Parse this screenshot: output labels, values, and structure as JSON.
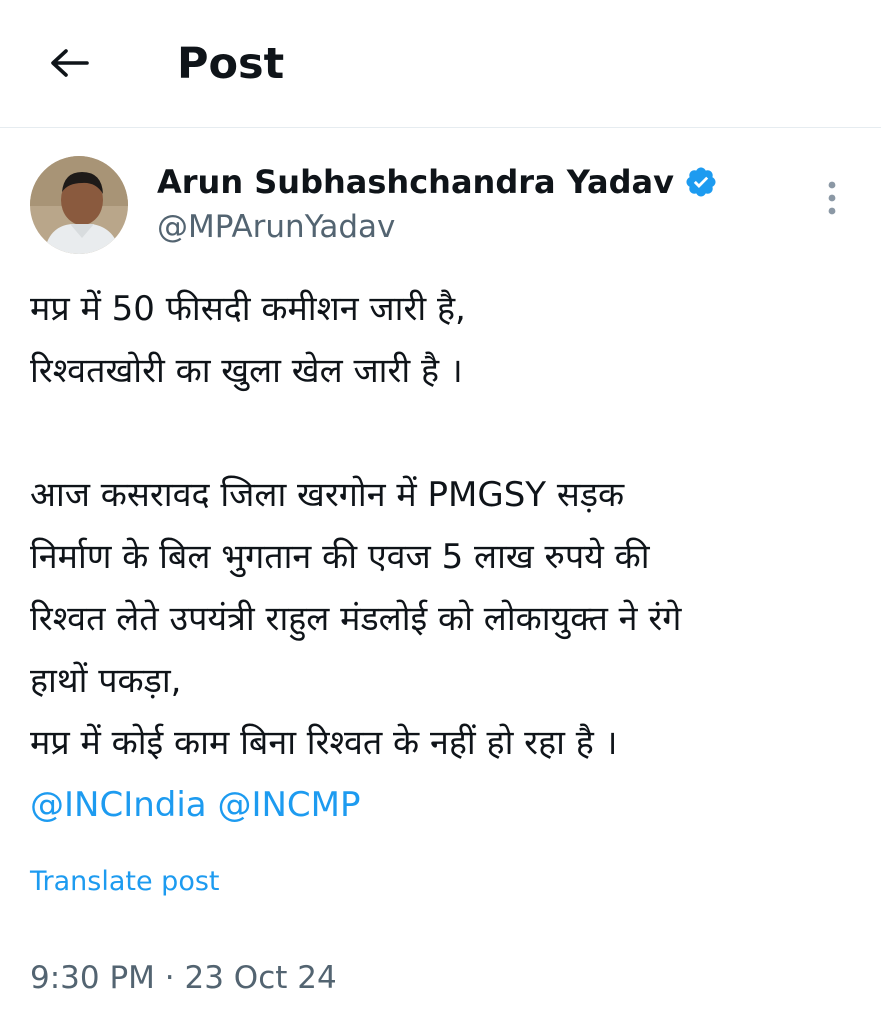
{
  "header": {
    "title": "Post",
    "back_icon": "arrow-left-icon"
  },
  "author": {
    "name": "Arun Subhashchandra Yadav",
    "handle": "@MPArunYadav",
    "verified": true,
    "verified_color": "#1d9bf0"
  },
  "post": {
    "lines": [
      "मप्र में 50 फीसदी कमीशन जारी है,",
      "रिश्वतखोरी का खुला खेल जारी है ।",
      "",
      "आज कसरावद जिला खरगोन में PMGSY सड़क",
      "निर्माण के बिल भुगतान की एवज 5 लाख रुपये की",
      "रिश्वत लेते उपयंत्री राहुल मंडलोई को लोकायुक्त ने रंगे",
      "हाथों पकड़ा,",
      "मप्र में कोई काम बिना रिश्वत के नहीं हो रहा है ।"
    ],
    "mentions": [
      "@INCIndia",
      "@INCMP"
    ],
    "translate_label": "Translate post",
    "time": "9:30 PM",
    "separator": "·",
    "date": "23 Oct 24"
  },
  "colors": {
    "link": "#1d9bf0",
    "secondary_text": "#536471",
    "primary_text": "#0f1419"
  }
}
